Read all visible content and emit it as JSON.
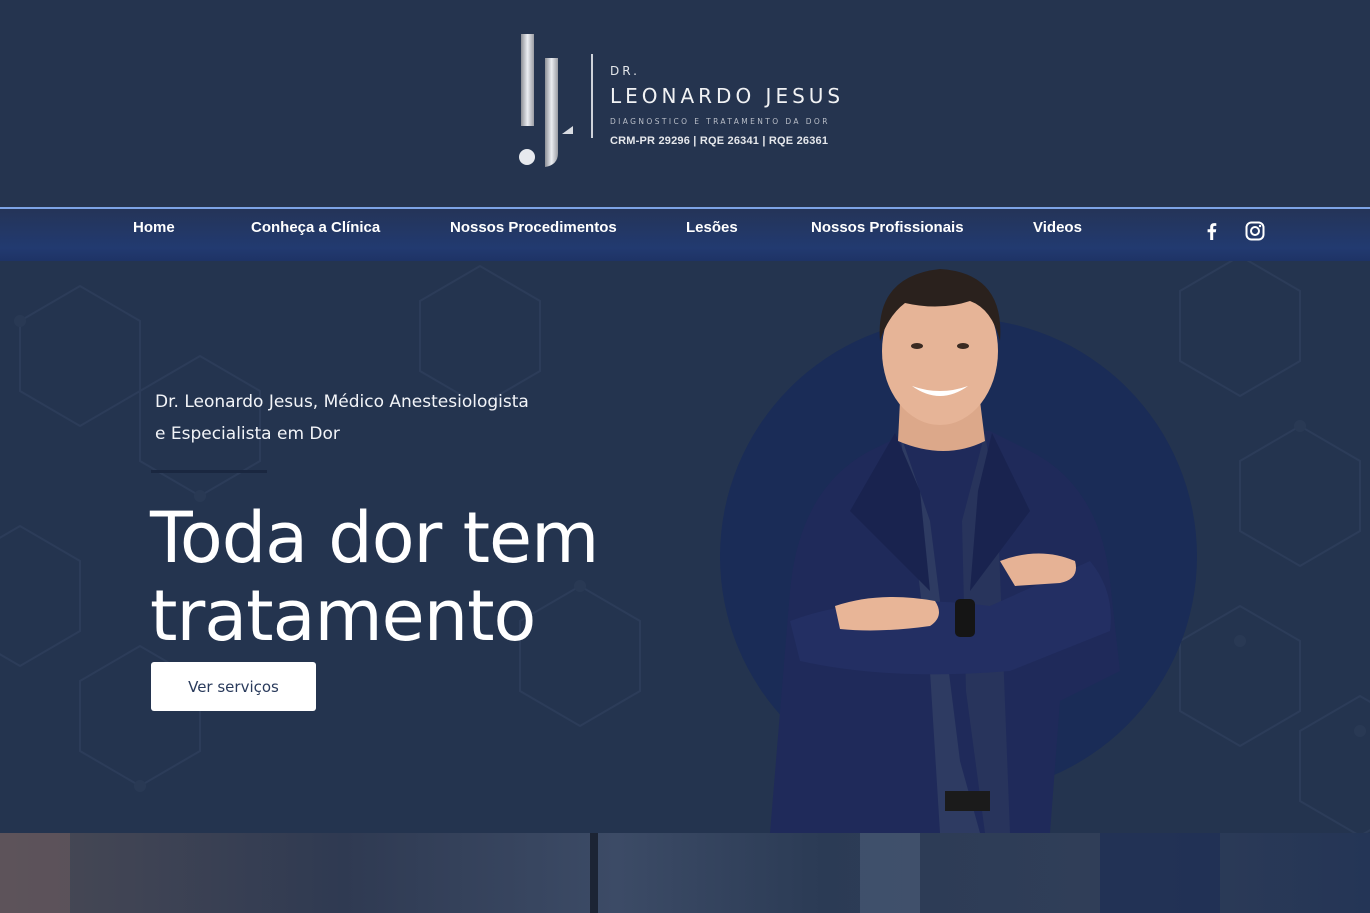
{
  "logo": {
    "dr": "DR.",
    "name": "LEONARDO JESUS",
    "tagline": "DIAGNOSTICO E TRATAMENTO DA DOR",
    "credentials": "CRM-PR 29296  |  RQE 26341  |  RQE 26361"
  },
  "nav": {
    "items": [
      {
        "label": "Home"
      },
      {
        "label": "Conheça a Clínica"
      },
      {
        "label": "Nossos Procedimentos"
      },
      {
        "label": "Lesões"
      },
      {
        "label": "Nossos Profissionais"
      },
      {
        "label": "Videos"
      }
    ],
    "social": [
      {
        "icon": "facebook-icon"
      },
      {
        "icon": "instagram-icon"
      }
    ]
  },
  "hero": {
    "subtitle_line1": "Dr. Leonardo Jesus, Médico Anestesiologista",
    "subtitle_line2": "e Especialista em Dor",
    "headline_line1": "Toda dor tem",
    "headline_line2": "tratamento",
    "cta_label": "Ver serviços"
  },
  "colors": {
    "background": "#24344f",
    "nav_accent": "#7da3e6",
    "circle": "#1a2c57",
    "button_text": "#2a3b5c"
  }
}
